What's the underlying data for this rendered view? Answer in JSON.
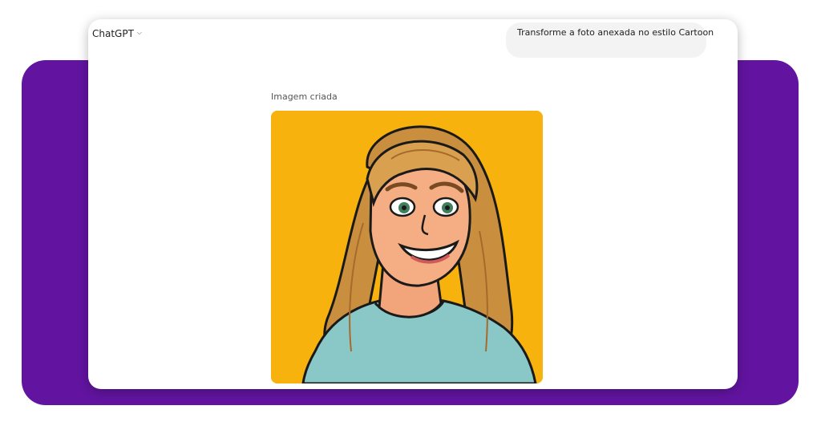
{
  "app": {
    "model_label": "ChatGPT"
  },
  "conversation": {
    "user_message": "Transforme a foto anexada no estilo Cartoon",
    "response_label": "Imagem criada"
  },
  "colors": {
    "backdrop": "#6214a0",
    "image_background": "#f7b20d"
  },
  "icons": {
    "model_dropdown": "chevron-down-icon"
  }
}
